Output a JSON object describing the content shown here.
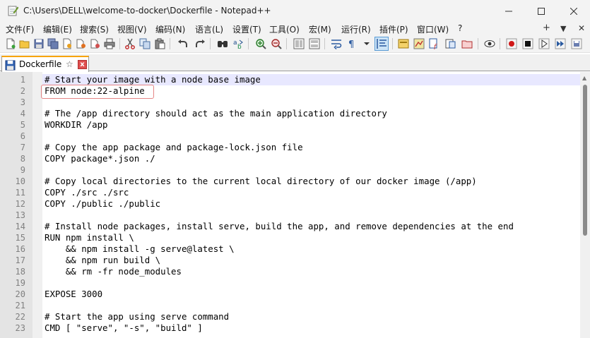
{
  "window": {
    "title": "C:\\Users\\DELL\\welcome-to-docker\\Dockerfile - Notepad++",
    "minimize_icon": "minimize-icon",
    "maximize_icon": "maximize-icon",
    "close_icon": "close-icon"
  },
  "menu": {
    "items": [
      "文件(F)",
      "编辑(E)",
      "搜索(S)",
      "视图(V)",
      "编码(N)",
      "语言(L)",
      "设置(T)",
      "工具(O)",
      "宏(M)",
      "运行(R)",
      "插件(P)",
      "窗口(W)",
      "?"
    ],
    "right": [
      "+",
      "▼",
      "✕"
    ]
  },
  "toolbar": {
    "icons": [
      "new-file-icon",
      "open-file-icon",
      "save-icon",
      "save-all-icon",
      "close-file-icon",
      "close-all-icon",
      "print-icon",
      "cut-icon",
      "copy-icon",
      "paste-icon",
      "undo-icon",
      "redo-icon",
      "find-icon",
      "replace-icon",
      "zoom-in-icon",
      "zoom-out-icon",
      "sync-vertical-icon",
      "sync-horizontal-icon",
      "word-wrap-icon",
      "show-all-chars-icon",
      "indent-guide-icon",
      "user-language-icon",
      "document-map-icon",
      "function-list-icon",
      "folder-workspace-icon",
      "monitoring-icon",
      "record-macro-icon",
      "stop-record-icon",
      "play-macro-icon",
      "run-macro-multiple-icon",
      "save-macro-icon"
    ]
  },
  "tab": {
    "label": "Dockerfile",
    "pin": "☆",
    "close": "x"
  },
  "editor": {
    "current_line": 1,
    "highlighted_line": 2,
    "lines": [
      {
        "n": "1",
        "text": "# Start your image with a node base image"
      },
      {
        "n": "2",
        "text": "FROM node:22-alpine"
      },
      {
        "n": "3",
        "text": ""
      },
      {
        "n": "4",
        "text": "# The /app directory should act as the main application directory"
      },
      {
        "n": "5",
        "text": "WORKDIR /app"
      },
      {
        "n": "6",
        "text": ""
      },
      {
        "n": "7",
        "text": "# Copy the app package and package-lock.json file"
      },
      {
        "n": "8",
        "text": "COPY package*.json ./"
      },
      {
        "n": "9",
        "text": ""
      },
      {
        "n": "10",
        "text": "# Copy local directories to the current local directory of our docker image (/app)"
      },
      {
        "n": "11",
        "text": "COPY ./src ./src"
      },
      {
        "n": "12",
        "text": "COPY ./public ./public"
      },
      {
        "n": "13",
        "text": ""
      },
      {
        "n": "14",
        "text": "# Install node packages, install serve, build the app, and remove dependencies at the end"
      },
      {
        "n": "15",
        "text": "RUN npm install \\"
      },
      {
        "n": "16",
        "text": "    && npm install -g serve@latest \\"
      },
      {
        "n": "17",
        "text": "    && npm run build \\"
      },
      {
        "n": "18",
        "text": "    && rm -fr node_modules"
      },
      {
        "n": "19",
        "text": ""
      },
      {
        "n": "20",
        "text": "EXPOSE 3000"
      },
      {
        "n": "21",
        "text": ""
      },
      {
        "n": "22",
        "text": "# Start the app using serve command"
      },
      {
        "n": "23",
        "text": "CMD [ \"serve\", \"-s\", \"build\" ]"
      }
    ]
  },
  "colors": {
    "accent_tab": "#f7a400",
    "current_line": "#e8e8ff",
    "highlight_border": "#e58585"
  }
}
